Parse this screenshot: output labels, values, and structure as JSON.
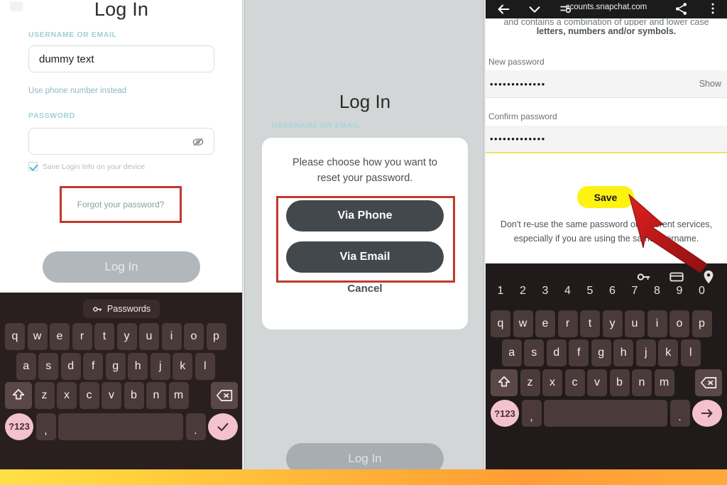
{
  "panels": {
    "login": {
      "title": "Log In",
      "username_label": "USERNAME OR EMAIL",
      "username_value": "dummy text",
      "use_phone_link": "Use phone number instead",
      "password_label": "PASSWORD",
      "password_value": "",
      "save_login_checkbox": "Save Login Info on your device",
      "forgot_link": "Forgot your password?",
      "login_button": "Log In",
      "eye_icon": "eye-off-icon",
      "highlight_color": "#c0392b"
    },
    "reset_dialog": {
      "title": "Log In",
      "username_label": "USERNAME OR EMAIL",
      "message_line1": "Please choose how you want to",
      "message_line2": "reset your password.",
      "via_phone_button": "Via Phone",
      "via_email_button": "Via Email",
      "cancel_button": "Cancel",
      "login_button": "Log In",
      "highlight_color": "#c0392b"
    },
    "browser": {
      "url": "ccounts.snapchat.com",
      "bar_icons": [
        "back-arrow-icon",
        "chevron-down-icon",
        "account-key-icon",
        "share-icon",
        "overflow-menu-icon"
      ],
      "help_clipped": "and contains a combination of upper and lower case",
      "help_text": "letters, numbers and/or symbols.",
      "new_password_label": "New password",
      "new_password_value": "•••••••••••••",
      "show_label": "Show",
      "confirm_password_label": "Confirm password",
      "confirm_password_value": "•••••••••••••",
      "save_button": "Save",
      "save_button_color": "#fdf311",
      "note_line1": "Don't re-use the same password on different services,",
      "note_line2": "especially if you are using the same username."
    }
  },
  "keyboard_light": {
    "chip_label": "Passwords",
    "chip_icon": "key-icon",
    "row1": [
      "q",
      "w",
      "e",
      "r",
      "t",
      "y",
      "u",
      "i",
      "o",
      "p"
    ],
    "row2": [
      "a",
      "s",
      "d",
      "f",
      "g",
      "h",
      "j",
      "k",
      "l"
    ],
    "row3": [
      "z",
      "x",
      "c",
      "v",
      "b",
      "n",
      "m"
    ],
    "shift_icon": "shift-up-icon",
    "backspace_icon": "backspace-icon",
    "symbols_key": "?123",
    "comma_key": ",",
    "period_key": ".",
    "action_icon": "check-icon"
  },
  "keyboard_dark": {
    "top_icons": [
      "key-icon",
      "credit-card-icon",
      "location-pin-icon"
    ],
    "numbers": [
      "1",
      "2",
      "3",
      "4",
      "5",
      "6",
      "7",
      "8",
      "9",
      "0"
    ],
    "row1": [
      "q",
      "w",
      "e",
      "r",
      "t",
      "y",
      "u",
      "i",
      "o",
      "p"
    ],
    "row2": [
      "a",
      "s",
      "d",
      "f",
      "g",
      "h",
      "j",
      "k",
      "l"
    ],
    "row3": [
      "z",
      "x",
      "c",
      "v",
      "b",
      "n",
      "m"
    ],
    "shift_icon": "shift-up-icon",
    "backspace_icon": "backspace-icon",
    "symbols_key": "?123",
    "comma_key": ",",
    "period_key": ".",
    "action_icon": "arrow-right-icon"
  },
  "annotations": {
    "pointer_arrow": "red-arrow-pointing-to-save-button",
    "arrow_color": "#d42020"
  },
  "footer": {
    "gradient_from": "#ffe046",
    "gradient_to": "#ff9d34"
  }
}
